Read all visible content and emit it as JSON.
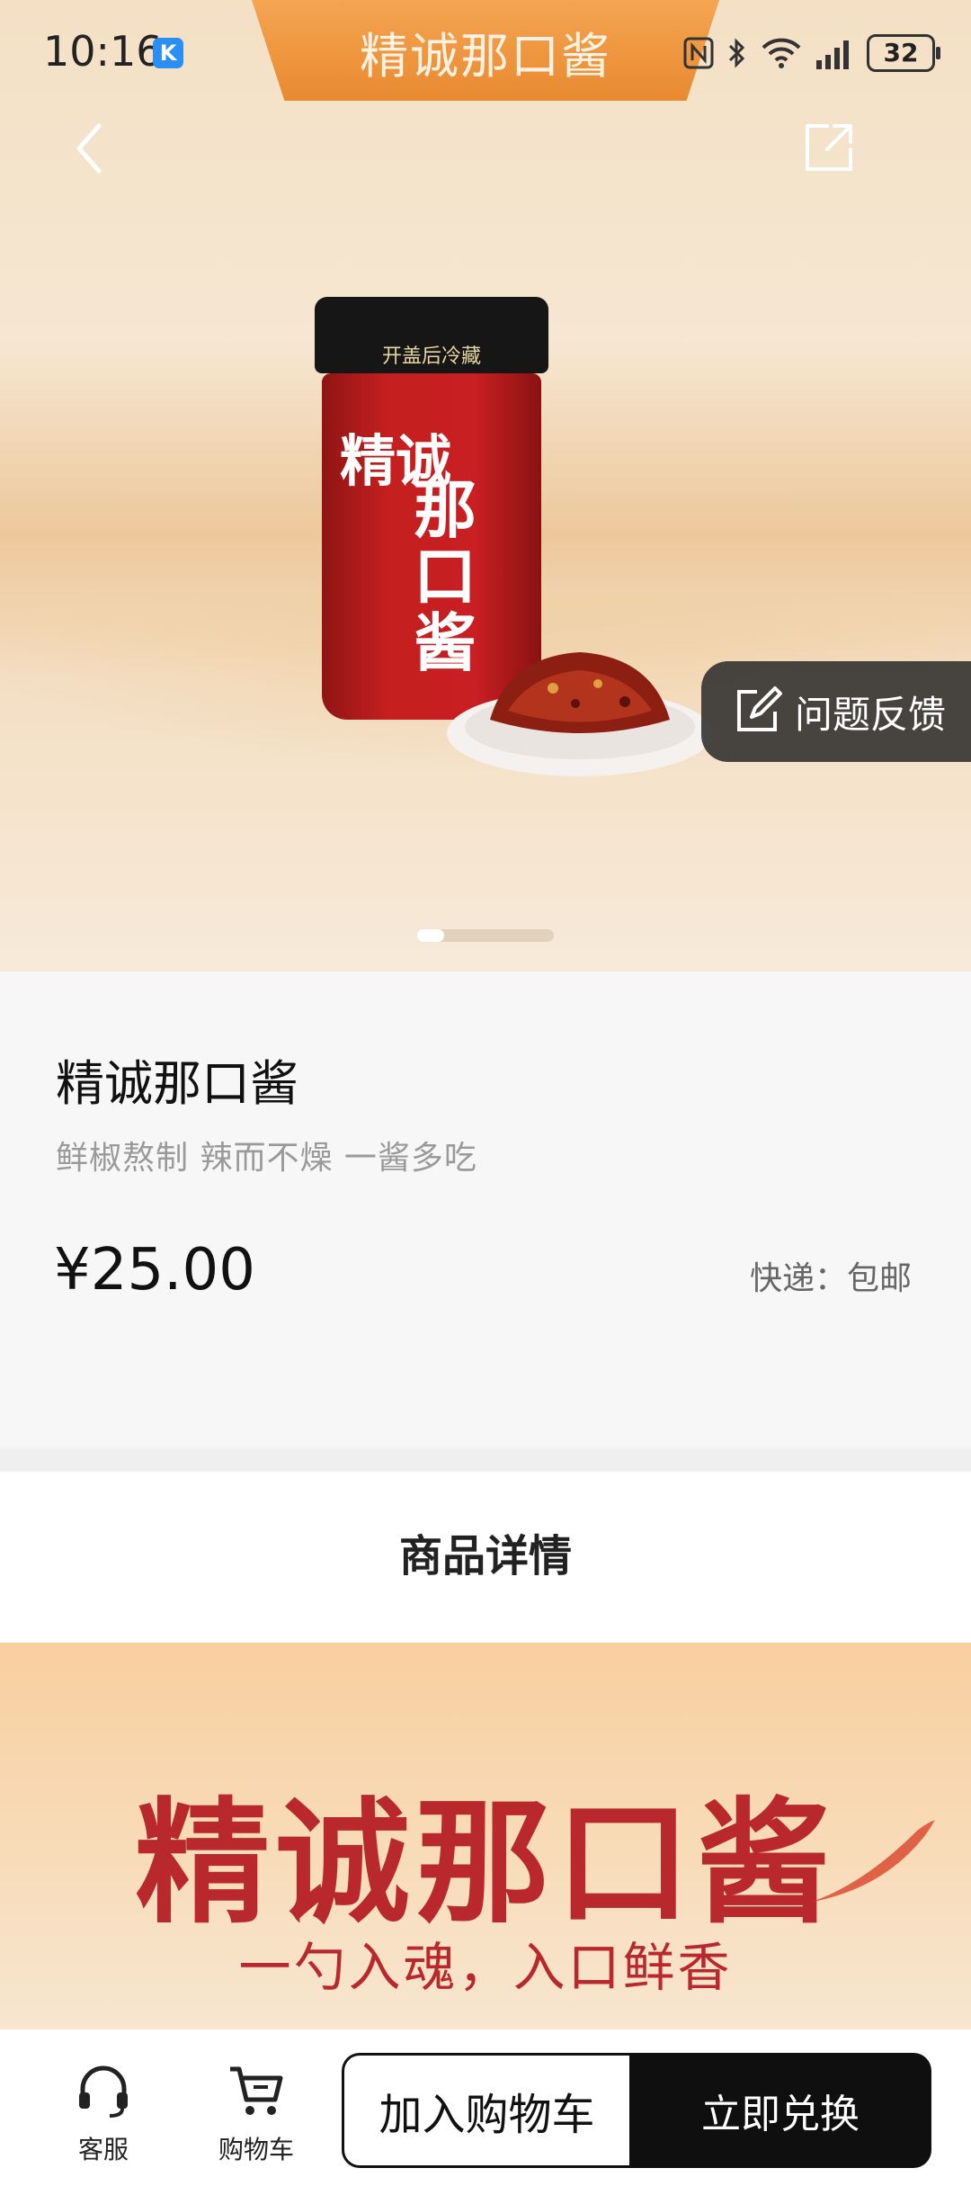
{
  "status_bar": {
    "time": "10:16",
    "app_badge": "K",
    "battery": "32"
  },
  "header": {
    "title": "精诚那口酱"
  },
  "hero": {
    "jar_lid_text": "开盖后冷藏",
    "jar_label_line1": "精诚",
    "jar_label_line2": "那口酱",
    "feedback_label": "问题反馈"
  },
  "product": {
    "name": "精诚那口酱",
    "subtitle": "鲜椒熬制 辣而不燥 一酱多吃",
    "price": "¥25.00",
    "shipping": "快递：包邮"
  },
  "detail": {
    "section_title": "商品详情",
    "banner_title": "精诚那口酱",
    "banner_slogan": "一勺入魂，入口鲜香"
  },
  "bottom_bar": {
    "customer_service": "客服",
    "cart": "购物车",
    "add_to_cart": "加入购物车",
    "redeem": "立即兑换"
  },
  "colors": {
    "accent_orange": "#e88a30",
    "banner_red": "#b8282c",
    "primary_button": "#0f0f0f"
  }
}
